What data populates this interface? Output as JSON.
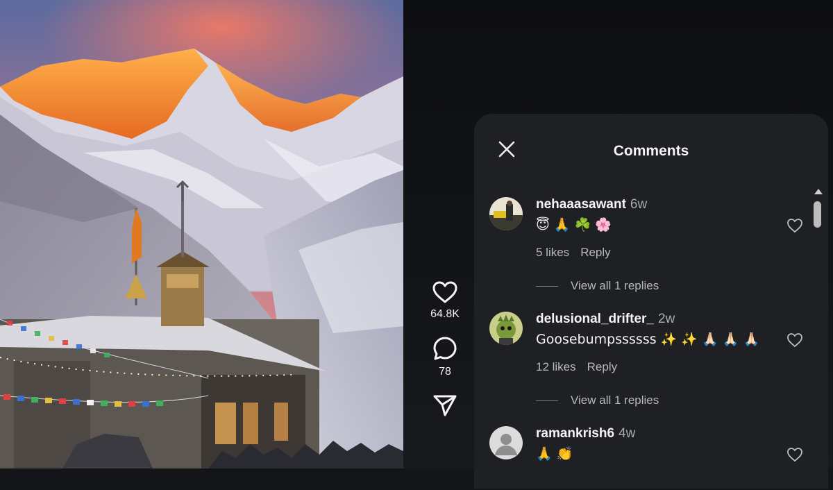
{
  "video": {
    "description_icon": "mountain-temple-video"
  },
  "actions": {
    "likes": "64.8K",
    "comments": "78",
    "like_icon": "heart-icon",
    "comment_icon": "comment-bubble-icon",
    "share_icon": "send-icon"
  },
  "panel": {
    "title": "Comments",
    "close_icon": "close-icon"
  },
  "comments": [
    {
      "user": "nehaaasawant",
      "time": "6w",
      "text": "😇 🙏 ☘️ 🌸",
      "likes": "5 likes",
      "reply": "Reply",
      "view_replies": "View all 1 replies"
    },
    {
      "user": "delusional_drifter_",
      "time": "2w",
      "text": "Goosebumpssssss ✨ ✨ 🙏🏻 🙏🏻 🙏🏻",
      "likes": "12 likes",
      "reply": "Reply",
      "view_replies": "View all 1 replies"
    },
    {
      "user": "ramankrish6",
      "time": "4w",
      "text": "🙏 👏"
    }
  ],
  "colors": {
    "panel_bg": "#1f2023",
    "page_bg": "#141518",
    "muted_text": "#b8b9bd"
  }
}
